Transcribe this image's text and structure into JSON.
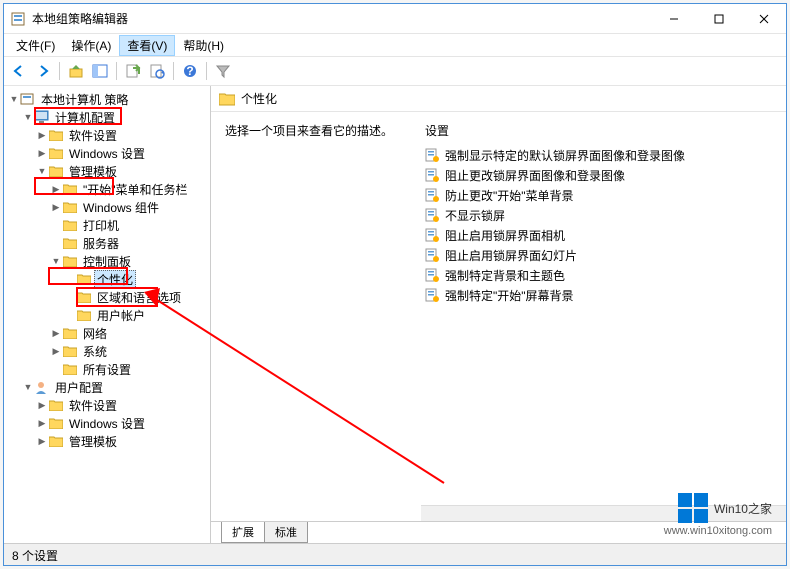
{
  "window": {
    "title": "本地组策略编辑器"
  },
  "menu": {
    "file": "文件(F)",
    "action": "操作(A)",
    "view": "查看(V)",
    "help": "帮助(H)"
  },
  "tree": {
    "root": "本地计算机 策略",
    "computer_config": "计算机配置",
    "software_settings": "软件设置",
    "windows_settings": "Windows 设置",
    "admin_templates": "管理模板",
    "start_taskbar": "\"开始\"菜单和任务栏",
    "windows_components": "Windows 组件",
    "printers": "打印机",
    "server": "服务器",
    "control_panel": "控制面板",
    "personalization": "个性化",
    "region_lang": "区域和语言选项",
    "user_accounts": "用户帐户",
    "network": "网络",
    "system": "系统",
    "all_settings": "所有设置",
    "user_config": "用户配置",
    "u_software_settings": "软件设置",
    "u_windows_settings": "Windows 设置",
    "u_admin_templates": "管理模板"
  },
  "content": {
    "header": "个性化",
    "prompt": "选择一个项目来查看它的描述。",
    "settings_header": "设置",
    "items": [
      "强制显示特定的默认锁屏界面图像和登录图像",
      "阻止更改锁屏界面图像和登录图像",
      "防止更改\"开始\"菜单背景",
      "不显示锁屏",
      "阻止启用锁屏界面相机",
      "阻止启用锁屏界面幻灯片",
      "强制特定背景和主题色",
      "强制特定\"开始\"屏幕背景"
    ],
    "tabs": {
      "extended": "扩展",
      "standard": "标准"
    }
  },
  "status": "8 个设置",
  "watermark": {
    "brand": "Win10",
    "suffix": "之家",
    "url": "www.win10xitong.com"
  }
}
